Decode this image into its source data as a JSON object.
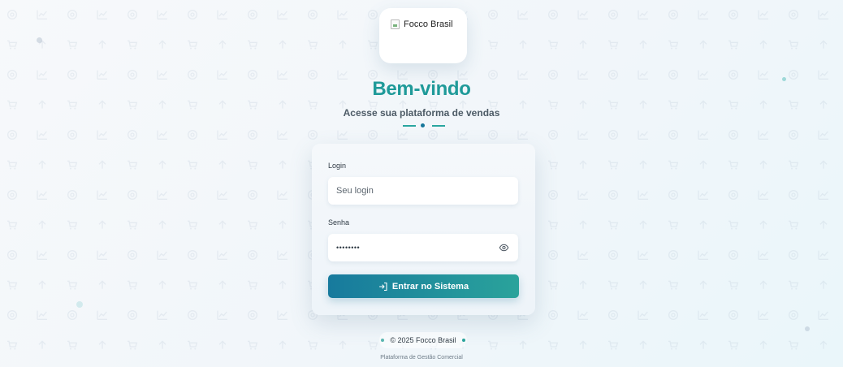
{
  "logo": {
    "alt": "Focco Brasil"
  },
  "heading": {
    "title": "Bem-vindo",
    "subtitle": "Acesse sua plataforma de vendas"
  },
  "form": {
    "login_label": "Login",
    "login_placeholder": "Seu login",
    "login_value": "",
    "password_label": "Senha",
    "password_value": "••••••••",
    "toggle_icon": "eye-icon",
    "submit_icon": "login-arrow-icon",
    "submit_label": "Entrar no Sistema"
  },
  "footer": {
    "copyright": "© 2025 Focco Brasil",
    "tagline": "Plataforma de Gestão Comercial"
  },
  "colors": {
    "accent_teal": "#1f9a99",
    "accent_blue": "#177a9d",
    "button_gradient_start": "#177a9d",
    "button_gradient_end": "#2aa39b",
    "footer_dot_left": "#5bb6b0",
    "footer_dot_right": "#2aa39b"
  },
  "background_pattern_icons": [
    "target-icon",
    "chart-line-icon",
    "cart-icon",
    "arrow-up-icon"
  ]
}
